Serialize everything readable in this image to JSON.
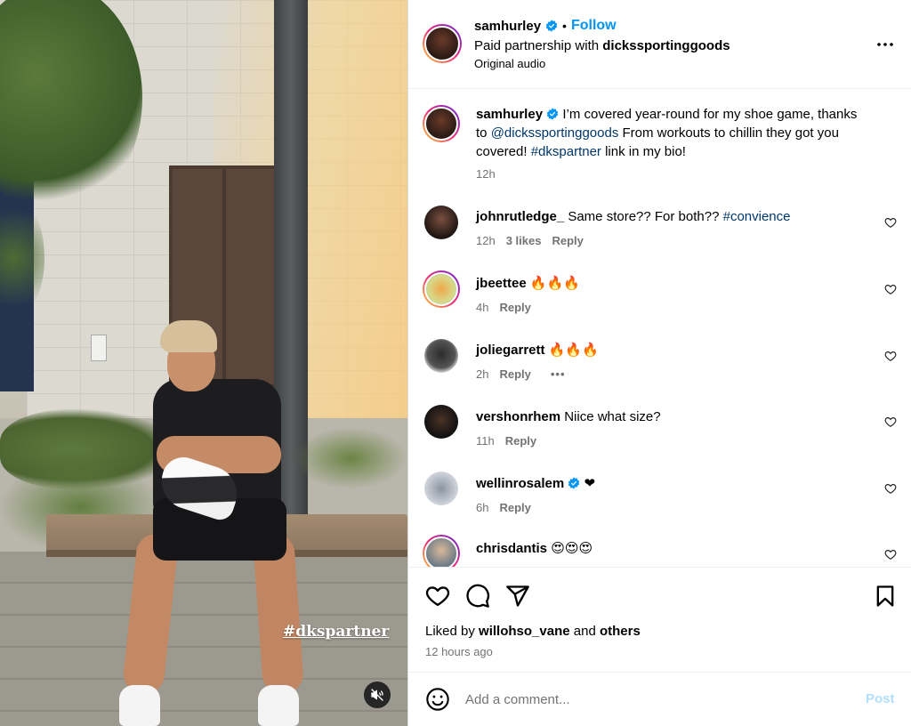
{
  "media": {
    "overlay_hashtag": "#dkspartner",
    "mute_icon": "speaker-muted-icon"
  },
  "header": {
    "username": "samhurley",
    "separator": "•",
    "follow_label": "Follow",
    "partnership_prefix": "Paid partnership with ",
    "partner": "dickssportinggoods",
    "audio": "Original audio"
  },
  "caption": {
    "username": "samhurley",
    "text_1": " I’m covered year-round for my shoe game, thanks to ",
    "mention": "@dickssportinggoods",
    "text_2": " From workouts to chillin they got you covered! ",
    "hashtag": "#dkspartner",
    "text_3": " link in my bio!",
    "time": "12h"
  },
  "comments": [
    {
      "username": "johnrutledge_",
      "text": " Same store?? For both?? ",
      "hashtag": "#convience",
      "time": "12h",
      "likes": "3 likes",
      "reply": "Reply"
    },
    {
      "username": "jbeettee",
      "text": " 🔥🔥🔥",
      "time": "4h",
      "reply": "Reply"
    },
    {
      "username": "joliegarrett",
      "text": " 🔥🔥🔥",
      "time": "2h",
      "reply": "Reply",
      "more": "•••"
    },
    {
      "username": "vershonrhem",
      "text": " Niice what size?",
      "time": "11h",
      "reply": "Reply"
    },
    {
      "username": "wellinrosalem",
      "text": " ❤",
      "time": "6h",
      "reply": "Reply"
    },
    {
      "username": "chrisdantis",
      "text": " 😍😍😍"
    }
  ],
  "footer": {
    "liked_prefix": "Liked by ",
    "liked_user": "willohso_vane",
    "liked_mid": " and ",
    "liked_others": "others",
    "time_ago": "12 hours ago",
    "comment_placeholder": "Add a comment...",
    "post_label": "Post"
  },
  "colors": {
    "accent": "#0095f6",
    "link": "#00376b",
    "muted": "#737373",
    "post_disabled": "#b2dffc"
  }
}
